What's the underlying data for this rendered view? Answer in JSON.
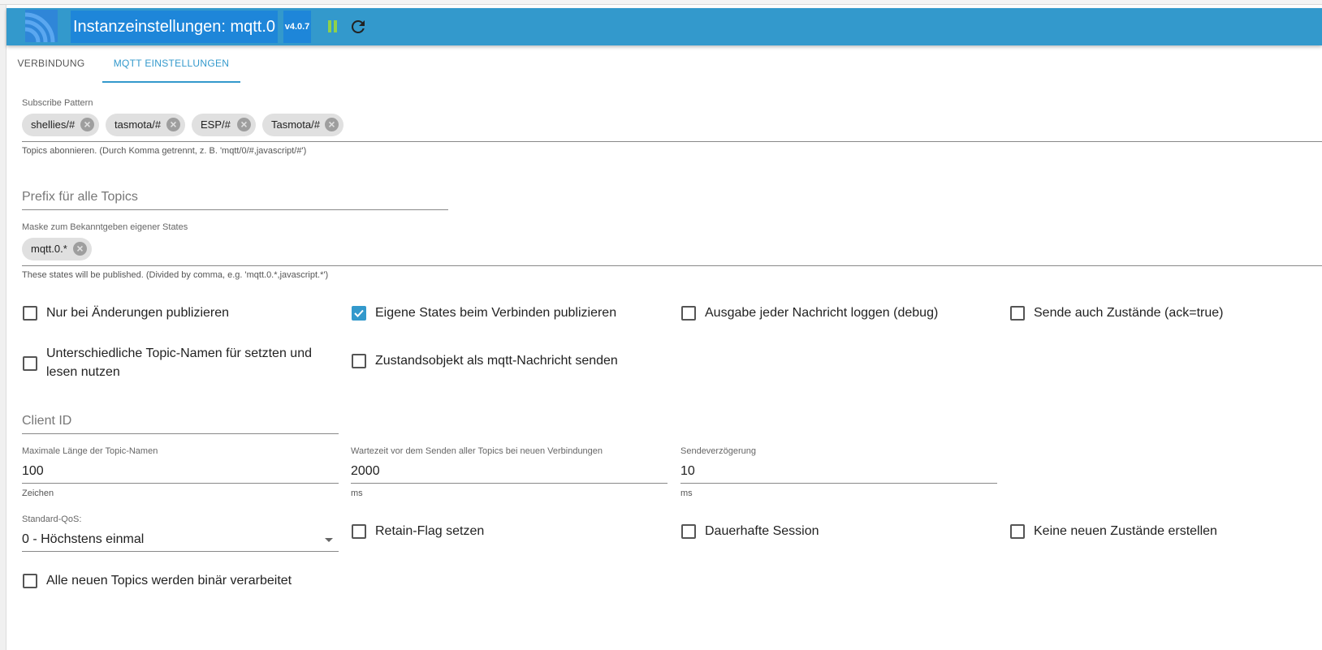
{
  "header": {
    "title": "Instanzeinstellungen: mqtt.0",
    "version": "v4.0.7"
  },
  "tabs": [
    {
      "label": "VERBINDUNG"
    },
    {
      "label": "MQTT EINSTELLUNGEN"
    }
  ],
  "subscribe": {
    "label": "Subscribe Pattern",
    "chips": [
      "shellies/#",
      "tasmota/#",
      "ESP/#",
      "Tasmota/#"
    ],
    "helper": "Topics abonnieren. (Durch Komma getrennt, z. B. 'mqtt/0/#,javascript/#')"
  },
  "prefix": {
    "placeholder": "Prefix für alle Topics"
  },
  "publish_mask": {
    "label": "Maske zum Bekanntgeben eigener States",
    "chips": [
      "mqtt.0.*"
    ],
    "helper": "These states will be published. (Divided by comma, e.g. 'mqtt.0.*,javascript.*')"
  },
  "checkboxes_row1": [
    {
      "label": "Nur bei Änderungen publizieren",
      "checked": false
    },
    {
      "label": "Eigene States beim Verbinden publizieren",
      "checked": true
    },
    {
      "label": "Ausgabe jeder Nachricht loggen (debug)",
      "checked": false
    },
    {
      "label": "Sende auch Zustände (ack=true)",
      "checked": false
    }
  ],
  "checkboxes_row2": [
    {
      "label_line1": "Unterschiedliche Topic-Namen für setzten und",
      "label_line2": "lesen nutzen",
      "checked": false
    },
    {
      "label": "Zustandsobjekt als mqtt-Nachricht senden",
      "checked": false
    }
  ],
  "client_id": {
    "placeholder": "Client ID"
  },
  "max_topic_length": {
    "label": "Maximale Länge der Topic-Namen",
    "value": "100",
    "unit": "Zeichen"
  },
  "wait_time": {
    "label": "Wartezeit vor dem Senden aller Topics bei neuen Verbindungen",
    "value": "2000",
    "unit": "ms"
  },
  "send_delay": {
    "label": "Sendeverzögerung",
    "value": "10",
    "unit": "ms"
  },
  "qos": {
    "label": "Standard-QoS:",
    "value": "0 - Höchstens einmal"
  },
  "checkboxes_row3": [
    {
      "label": "Retain-Flag setzen",
      "checked": false
    },
    {
      "label": "Dauerhafte Session",
      "checked": false
    },
    {
      "label": "Keine neuen Zustände erstellen",
      "checked": false
    }
  ],
  "checkboxes_row4": [
    {
      "label": "Alle neuen Topics werden binär verarbeitet",
      "checked": false
    }
  ],
  "colors": {
    "header_bg": "#3399cc",
    "accent": "#3399cc",
    "title_highlight": "#1e86d9"
  }
}
